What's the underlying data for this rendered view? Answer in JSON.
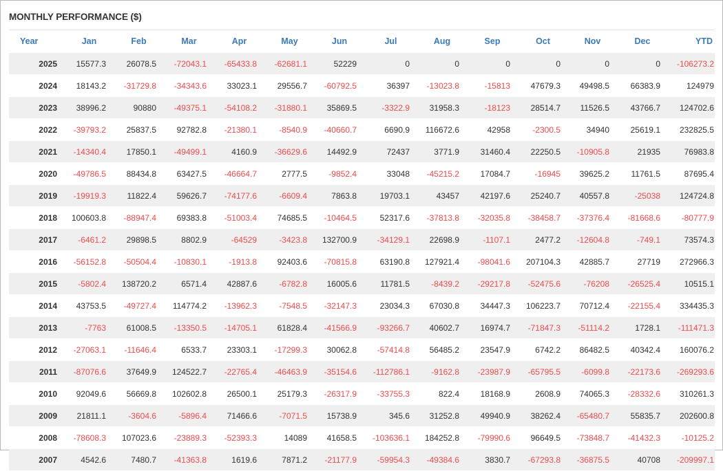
{
  "panel": {
    "title": "MONTHLY PERFORMANCE ($)"
  },
  "table": {
    "columns": [
      "Year",
      "Jan",
      "Feb",
      "Mar",
      "Apr",
      "May",
      "Jun",
      "Jul",
      "Aug",
      "Sep",
      "Oct",
      "Nov",
      "Dec",
      "YTD"
    ],
    "rows": [
      [
        "2025",
        "15577.3",
        "26078.5",
        "-72043.1",
        "-65433.8",
        "-62681.1",
        "52229",
        "0",
        "0",
        "0",
        "0",
        "0",
        "0",
        "-106273.2"
      ],
      [
        "2024",
        "18143.2",
        "-31729.8",
        "-34343.6",
        "33023.1",
        "29556.7",
        "-60792.5",
        "36397",
        "-13023.8",
        "-15813",
        "47679.3",
        "49498.5",
        "66383.9",
        "124979"
      ],
      [
        "2023",
        "38996.2",
        "90880",
        "-49375.1",
        "-54108.2",
        "-31880.1",
        "35869.5",
        "-3322.9",
        "31958.3",
        "-18123",
        "28514.7",
        "11526.5",
        "43766.7",
        "124702.6"
      ],
      [
        "2022",
        "-39793.2",
        "25837.5",
        "92782.8",
        "-21380.1",
        "-8540.9",
        "-40660.7",
        "6690.9",
        "116672.6",
        "42958",
        "-2300.5",
        "34940",
        "25619.1",
        "232825.5"
      ],
      [
        "2021",
        "-14340.4",
        "17850.1",
        "-49499.1",
        "4160.9",
        "-36629.6",
        "14492.9",
        "72437",
        "3771.9",
        "31460.4",
        "22250.5",
        "-10905.8",
        "21935",
        "76983.8"
      ],
      [
        "2020",
        "-49786.5",
        "88434.8",
        "63427.5",
        "-46664.7",
        "2777.5",
        "-9852.4",
        "33048",
        "-45215.2",
        "17084.7",
        "-16945",
        "39625.2",
        "11761.5",
        "87695.4"
      ],
      [
        "2019",
        "-19919.3",
        "11822.4",
        "59626.7",
        "-74177.6",
        "-6609.4",
        "7863.8",
        "19703.1",
        "43457",
        "42197.6",
        "25240.7",
        "40557.8",
        "-25038",
        "124724.8"
      ],
      [
        "2018",
        "100603.8",
        "-88947.4",
        "69383.8",
        "-51003.4",
        "74685.5",
        "-10464.5",
        "52317.6",
        "-37813.8",
        "-32035.8",
        "-38458.7",
        "-37376.4",
        "-81668.6",
        "-80777.9"
      ],
      [
        "2017",
        "-6461.2",
        "29898.5",
        "8802.9",
        "-64529",
        "-3423.8",
        "132700.9",
        "-34129.1",
        "22698.9",
        "-1107.1",
        "2477.2",
        "-12604.8",
        "-749.1",
        "73574.3"
      ],
      [
        "2016",
        "-56152.8",
        "-50504.4",
        "-10830.1",
        "-1913.8",
        "92403.6",
        "-70815.8",
        "63190.8",
        "127921.4",
        "-98041.6",
        "207104.3",
        "42885.7",
        "27719",
        "272966.3"
      ],
      [
        "2015",
        "-5802.4",
        "138720.2",
        "6571.4",
        "42887.6",
        "-6782.8",
        "16005.6",
        "11781.5",
        "-8439.2",
        "-29217.8",
        "-52475.6",
        "-76208",
        "-26525.4",
        "10515.1"
      ],
      [
        "2014",
        "43753.5",
        "-49727.4",
        "114774.2",
        "-13962.3",
        "-7548.5",
        "-32147.3",
        "23034.3",
        "67030.8",
        "34447.3",
        "106223.7",
        "70712.4",
        "-22155.4",
        "334435.3"
      ],
      [
        "2013",
        "-7763",
        "61008.5",
        "-13350.5",
        "-14705.1",
        "61828.4",
        "-41566.9",
        "-93266.7",
        "40602.7",
        "16974.7",
        "-71847.3",
        "-51114.2",
        "1728.1",
        "-111471.3"
      ],
      [
        "2012",
        "-27063.1",
        "-11646.4",
        "6533.7",
        "23303.1",
        "-17299.3",
        "30062.8",
        "-57414.8",
        "56485.2",
        "23547.9",
        "6742.2",
        "86482.5",
        "40342.4",
        "160076.2"
      ],
      [
        "2011",
        "-87076.6",
        "37649.9",
        "124522.7",
        "-22765.4",
        "-46463.9",
        "-35154.6",
        "-112786.1",
        "-9162.8",
        "-23987.9",
        "-65795.5",
        "-6099.8",
        "-22173.6",
        "-269293.6"
      ],
      [
        "2010",
        "92049.6",
        "56669.8",
        "102602.8",
        "26500.1",
        "25179.3",
        "-26317.9",
        "-33755.3",
        "822.4",
        "18168.9",
        "2608.9",
        "74065.3",
        "-28332.6",
        "310261.3"
      ],
      [
        "2009",
        "21811.1",
        "-3604.6",
        "-5896.4",
        "71466.6",
        "-7071.5",
        "15738.9",
        "345.6",
        "31252.8",
        "49940.9",
        "38262.4",
        "-65480.7",
        "55835.7",
        "202600.8"
      ],
      [
        "2008",
        "-78608.3",
        "107023.6",
        "-23889.3",
        "-52393.3",
        "14089",
        "41658.5",
        "-103636.1",
        "184252.8",
        "-79990.6",
        "96649.5",
        "-73848.7",
        "-41432.3",
        "-10125.2"
      ],
      [
        "2007",
        "4542.6",
        "7480.7",
        "-41363.8",
        "1619.6",
        "7871.2",
        "-21177.9",
        "-59954.3",
        "-49384.6",
        "3830.7",
        "-67293.8",
        "-36875.5",
        "40708",
        "-209997.1"
      ]
    ]
  },
  "colors": {
    "header_text": "#3b7ab8",
    "negative_text": "#ef4b4b",
    "positive_text": "#333333",
    "stripe_background": "#efefef"
  }
}
